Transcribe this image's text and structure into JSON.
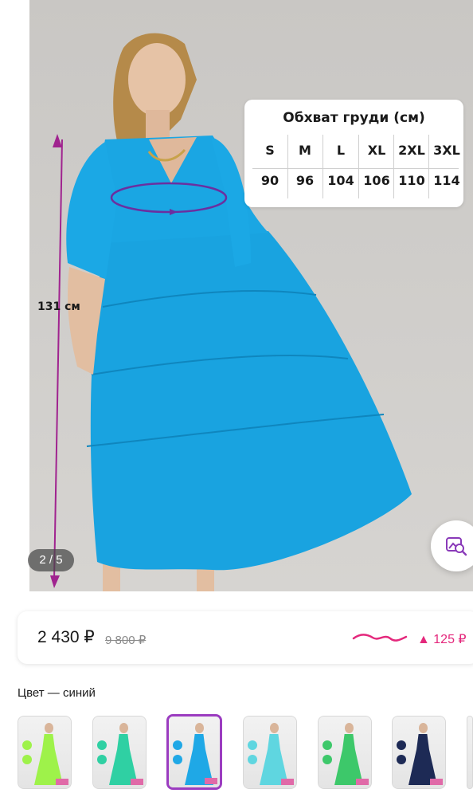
{
  "gallery": {
    "counter": "2 / 5",
    "length_label": "131 см",
    "size_chart": {
      "title": "Обхват груди (см)",
      "sizes": [
        "S",
        "M",
        "L",
        "XL",
        "2XL",
        "3XL"
      ],
      "values": [
        "90",
        "96",
        "104",
        "106",
        "110",
        "114"
      ]
    },
    "search_icon": "image-search-icon"
  },
  "price": {
    "current": "2 430 ₽",
    "old": "9 800 ₽",
    "trend_icon": "price-trend-icon",
    "delta": "▲ 125 ₽",
    "accent_color": "#e4287c"
  },
  "color_section": {
    "label": "Цвет — синий",
    "swatches": [
      {
        "color": "#9ef24a",
        "selected": false
      },
      {
        "color": "#2fd0a3",
        "selected": false
      },
      {
        "color": "#1fa8e6",
        "selected": true
      },
      {
        "color": "#5fd6e0",
        "selected": false
      },
      {
        "color": "#3dc86a",
        "selected": false
      },
      {
        "color": "#1d2a55",
        "selected": false
      }
    ]
  },
  "colors": {
    "dress": "#19a3e0",
    "selection_border": "#9b3cc0",
    "measure_line": "#a0238f"
  }
}
